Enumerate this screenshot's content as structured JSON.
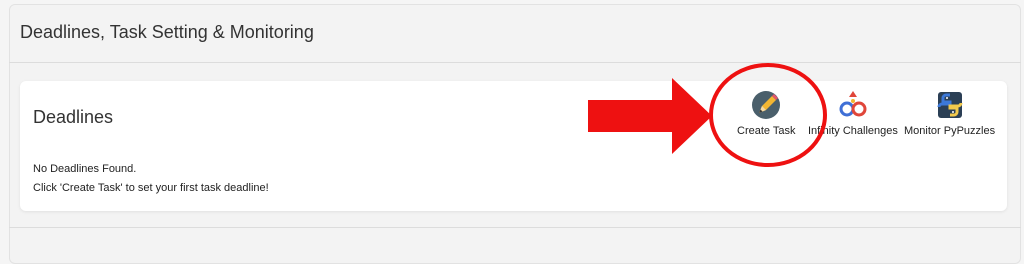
{
  "section": {
    "title": "Deadlines, Task Setting & Monitoring"
  },
  "deadlines": {
    "title": "Deadlines",
    "empty_message": "No Deadlines Found.",
    "hint": "Click 'Create Task' to set your first task deadline!"
  },
  "actions": [
    {
      "label": "Create Task",
      "icon": "pencil-icon"
    },
    {
      "label": "Infinity Challenges",
      "icon": "infinity-icon"
    },
    {
      "label": "Monitor PyPuzzles",
      "icon": "python-logo-icon"
    }
  ],
  "annotation": {
    "arrow_color": "#ee1111",
    "circle_color": "#ee1111"
  }
}
